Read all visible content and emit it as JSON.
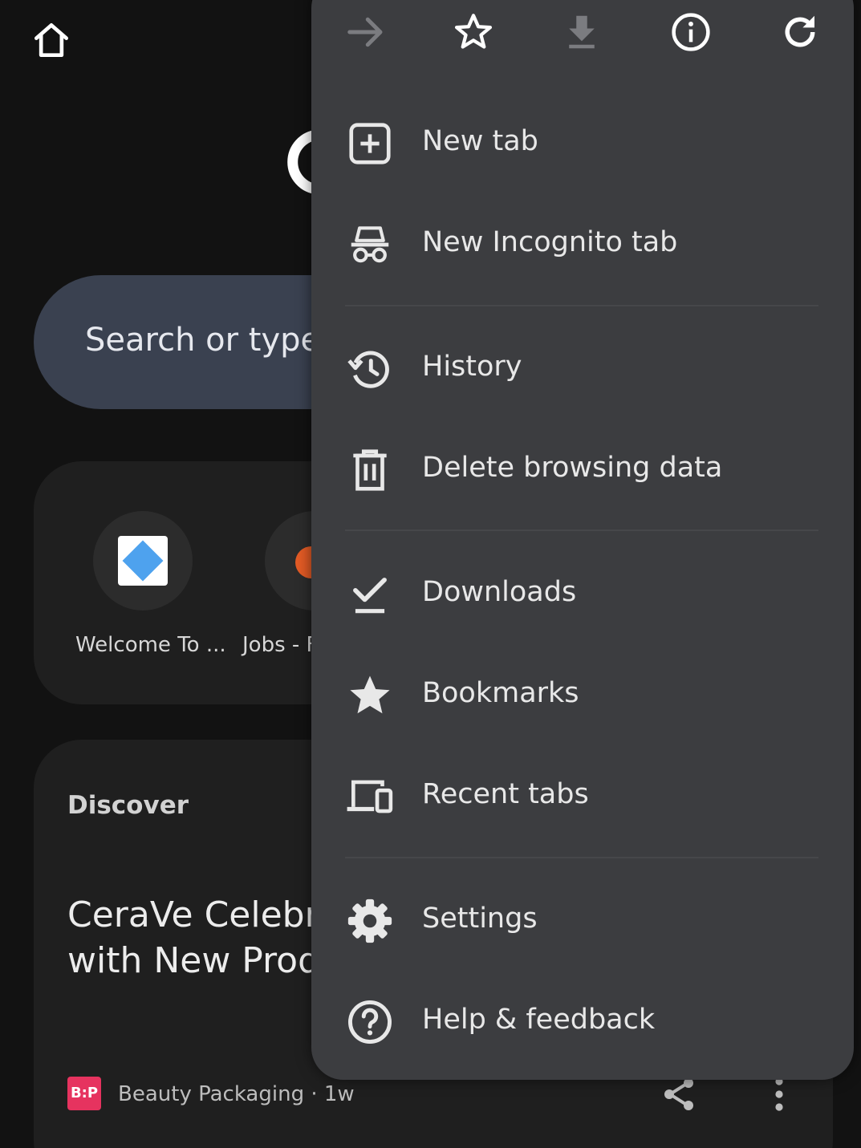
{
  "background": {
    "search": {
      "placeholder": "Search or type"
    },
    "shortcuts": [
      {
        "label": "Welcome To ..."
      },
      {
        "label": "Jobs - F"
      }
    ],
    "discover": {
      "heading": "Discover",
      "article_title": "CeraVe Celebra\nwith New Prod",
      "source_badge": "B:P",
      "source": "Beauty Packaging · 1w"
    }
  },
  "menu": {
    "toolbar": [
      {
        "icon": "forward-arrow-icon"
      },
      {
        "icon": "star-outline-icon"
      },
      {
        "icon": "download-icon"
      },
      {
        "icon": "info-icon"
      },
      {
        "icon": "refresh-icon"
      }
    ],
    "items": [
      {
        "label": "New tab",
        "icon": "plus-box-icon"
      },
      {
        "label": "New Incognito tab",
        "icon": "incognito-icon"
      },
      {
        "label": "History",
        "icon": "history-icon"
      },
      {
        "label": "Delete browsing data",
        "icon": "trash-icon"
      },
      {
        "label": "Downloads",
        "icon": "downloads-check-icon"
      },
      {
        "label": "Bookmarks",
        "icon": "star-filled-icon"
      },
      {
        "label": "Recent tabs",
        "icon": "devices-icon"
      },
      {
        "label": "Settings",
        "icon": "gear-icon"
      },
      {
        "label": "Help & feedback",
        "icon": "help-icon"
      }
    ]
  },
  "colors": {
    "page_bg": "#121212",
    "menu_bg": "#3c3d40",
    "search_bg": "#3a4150",
    "text": "#e8e8e8"
  }
}
